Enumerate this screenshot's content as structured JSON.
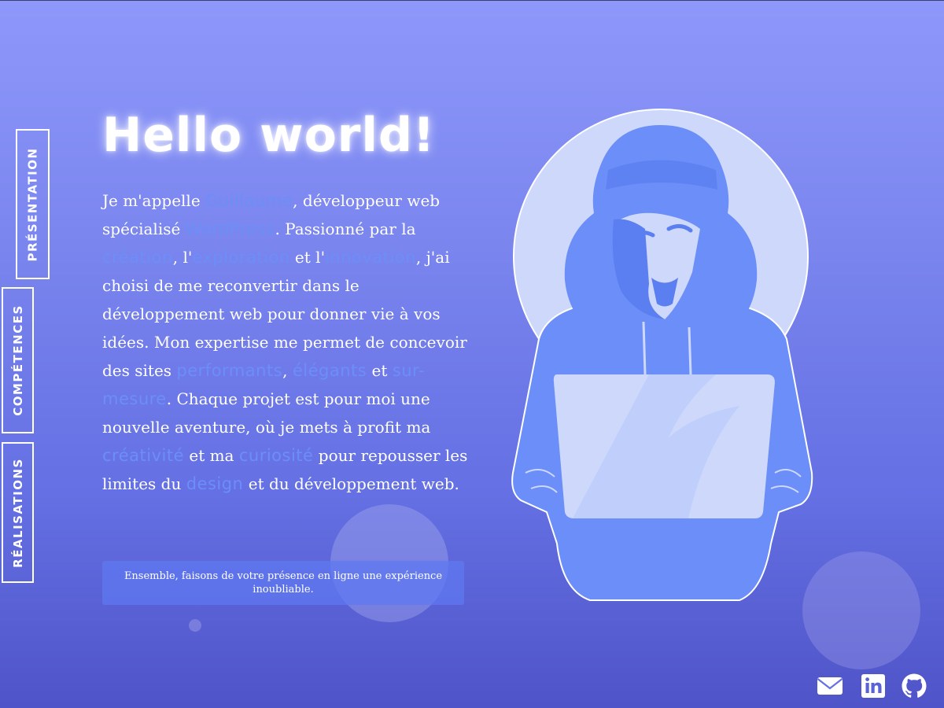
{
  "nav": {
    "items": [
      {
        "label": "PRÉSENTATION"
      },
      {
        "label": "COMPÉTENCES"
      },
      {
        "label": "RÉALISATIONS"
      }
    ]
  },
  "hero": {
    "title": "Hello world!",
    "paragraph": [
      {
        "text": "Je m'appelle "
      },
      {
        "text": "Guillaume",
        "highlight": true
      },
      {
        "text": ", développeur web spécialisé "
      },
      {
        "text": "WordPress",
        "highlight": true
      },
      {
        "text": ". Passionné par la "
      },
      {
        "text": "création",
        "highlight": true
      },
      {
        "text": ", l'"
      },
      {
        "text": "exploration",
        "highlight": true
      },
      {
        "text": " et l'"
      },
      {
        "text": "innovation",
        "highlight": true
      },
      {
        "text": ", j'ai choisi de me reconvertir dans le développement web pour donner vie à vos idées. Mon expertise me permet de concevoir des sites "
      },
      {
        "text": "performants",
        "highlight": true
      },
      {
        "text": ", "
      },
      {
        "text": "élégants",
        "highlight": true
      },
      {
        "text": " et "
      },
      {
        "text": "sur-mesure",
        "highlight": true
      },
      {
        "text": ". Chaque projet est pour moi une nouvelle aventure, où je mets à profit ma "
      },
      {
        "text": "créativité",
        "highlight": true
      },
      {
        "text": " et ma "
      },
      {
        "text": "curiosité",
        "highlight": true
      },
      {
        "text": " pour repousser les limites du "
      },
      {
        "text": "design",
        "highlight": true
      },
      {
        "text": " et du développement web."
      }
    ],
    "callout": "Ensemble, faisons de votre présence en ligne une expérience inoubliable."
  },
  "social": {
    "items": [
      {
        "icon": "mail-icon"
      },
      {
        "icon": "linkedin-icon"
      },
      {
        "icon": "github-icon"
      }
    ]
  },
  "colors": {
    "background_top": "#8e98fb",
    "background_bottom": "#4f54c8",
    "highlight": "#6b8ef8",
    "illustration_blue": "#6b8ef8",
    "illustration_light": "#cdd8fb"
  }
}
